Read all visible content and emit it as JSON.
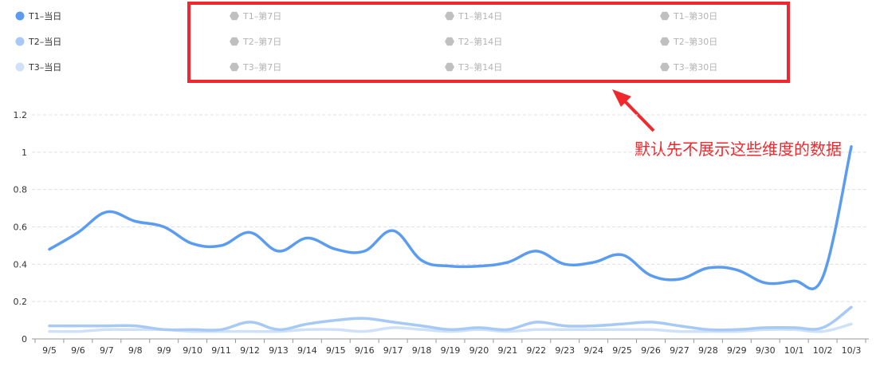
{
  "chart_data": {
    "type": "line",
    "categories": [
      "9/5",
      "9/6",
      "9/7",
      "9/8",
      "9/9",
      "9/10",
      "9/11",
      "9/12",
      "9/13",
      "9/14",
      "9/15",
      "9/16",
      "9/17",
      "9/18",
      "9/19",
      "9/20",
      "9/21",
      "9/22",
      "9/23",
      "9/24",
      "9/25",
      "9/26",
      "9/27",
      "9/28",
      "9/29",
      "9/30",
      "10/1",
      "10/2",
      "10/3"
    ],
    "ylim": [
      0,
      1.2
    ],
    "yticks": [
      "0",
      "0.2",
      "0.4",
      "0.6",
      "0.8",
      "1",
      "1.2"
    ],
    "grid": true,
    "legend_placement": "top",
    "series": [
      {
        "name": "T1–当日",
        "color": "#5b9cf0",
        "active": true,
        "values": [
          0.48,
          0.57,
          0.68,
          0.63,
          0.6,
          0.51,
          0.5,
          0.57,
          0.47,
          0.54,
          0.48,
          0.47,
          0.58,
          0.42,
          0.39,
          0.39,
          0.41,
          0.47,
          0.4,
          0.41,
          0.45,
          0.34,
          0.32,
          0.38,
          0.37,
          0.3,
          0.31,
          0.33,
          1.03
        ]
      },
      {
        "name": "T2–当日",
        "color": "#a6c9f5",
        "active": true,
        "values": [
          0.07,
          0.07,
          0.07,
          0.07,
          0.05,
          0.05,
          0.05,
          0.09,
          0.05,
          0.08,
          0.1,
          0.11,
          0.09,
          0.07,
          0.05,
          0.06,
          0.05,
          0.09,
          0.07,
          0.07,
          0.08,
          0.09,
          0.07,
          0.05,
          0.05,
          0.06,
          0.06,
          0.06,
          0.17
        ]
      },
      {
        "name": "T3–当日",
        "color": "#cfe1f9",
        "active": true,
        "values": [
          0.04,
          0.04,
          0.05,
          0.05,
          0.05,
          0.04,
          0.04,
          0.04,
          0.04,
          0.05,
          0.05,
          0.04,
          0.06,
          0.05,
          0.04,
          0.05,
          0.04,
          0.05,
          0.05,
          0.05,
          0.05,
          0.05,
          0.04,
          0.04,
          0.04,
          0.05,
          0.05,
          0.04,
          0.08
        ]
      },
      {
        "name": "T1–第7日",
        "color": "#c0c0c0",
        "active": false
      },
      {
        "name": "T1–第14日",
        "color": "#c0c0c0",
        "active": false
      },
      {
        "name": "T1–第30日",
        "color": "#c0c0c0",
        "active": false
      },
      {
        "name": "T2–第7日",
        "color": "#c0c0c0",
        "active": false
      },
      {
        "name": "T2–第14日",
        "color": "#c0c0c0",
        "active": false
      },
      {
        "name": "T2–第30日",
        "color": "#c0c0c0",
        "active": false
      },
      {
        "name": "T3–第7日",
        "color": "#c0c0c0",
        "active": false
      },
      {
        "name": "T3–第14日",
        "color": "#c0c0c0",
        "active": false
      },
      {
        "name": "T3–第30日",
        "color": "#c0c0c0",
        "active": false
      }
    ]
  },
  "annotation": {
    "text": "默认先不展示这些维度的数据",
    "color": "#f0282d"
  },
  "colors": {
    "grid": "#e0e0e0",
    "axis": "#999999",
    "tick_text": "#333333",
    "inactive_text": "#b3b3b3"
  }
}
